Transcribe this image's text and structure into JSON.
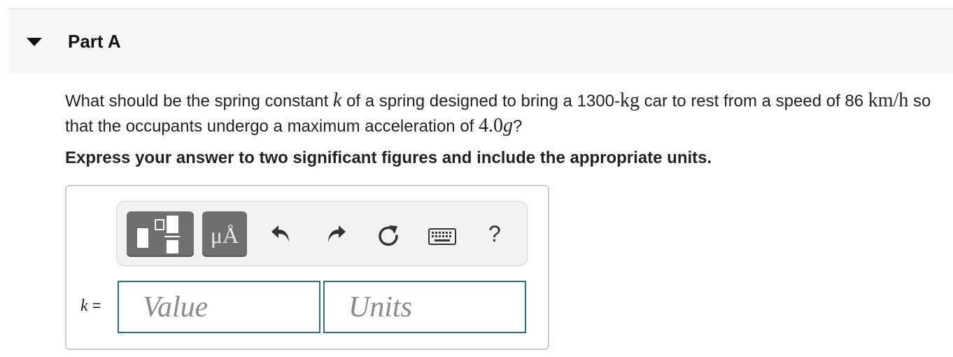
{
  "part": {
    "title": "Part A"
  },
  "question": {
    "seg1": "What should be the spring constant ",
    "k": "k",
    "seg2": " of a spring designed to bring a 1300-",
    "kg": "kg",
    "seg3": " car to rest from a speed of 86 ",
    "kmh": "km/h",
    "seg4": " so that the occupants undergo a maximum acceleration of ",
    "accel": "4.0",
    "g": "g",
    "seg5": "?"
  },
  "instruction": "Express your answer to two significant figures and include the appropriate units.",
  "toolbar": {
    "units_label": "μÅ",
    "help_label": "?",
    "icons": [
      "templates-icon",
      "units-icon",
      "undo-icon",
      "redo-icon",
      "reset-icon",
      "keyboard-icon",
      "help-icon"
    ]
  },
  "answer": {
    "var": "k",
    "equals": " =",
    "value_placeholder": "Value",
    "units_placeholder": "Units"
  },
  "colors": {
    "header_bg": "#f7f7f7",
    "toolbar_button": "#6f6f6f",
    "field_border": "#2c6e8a"
  }
}
